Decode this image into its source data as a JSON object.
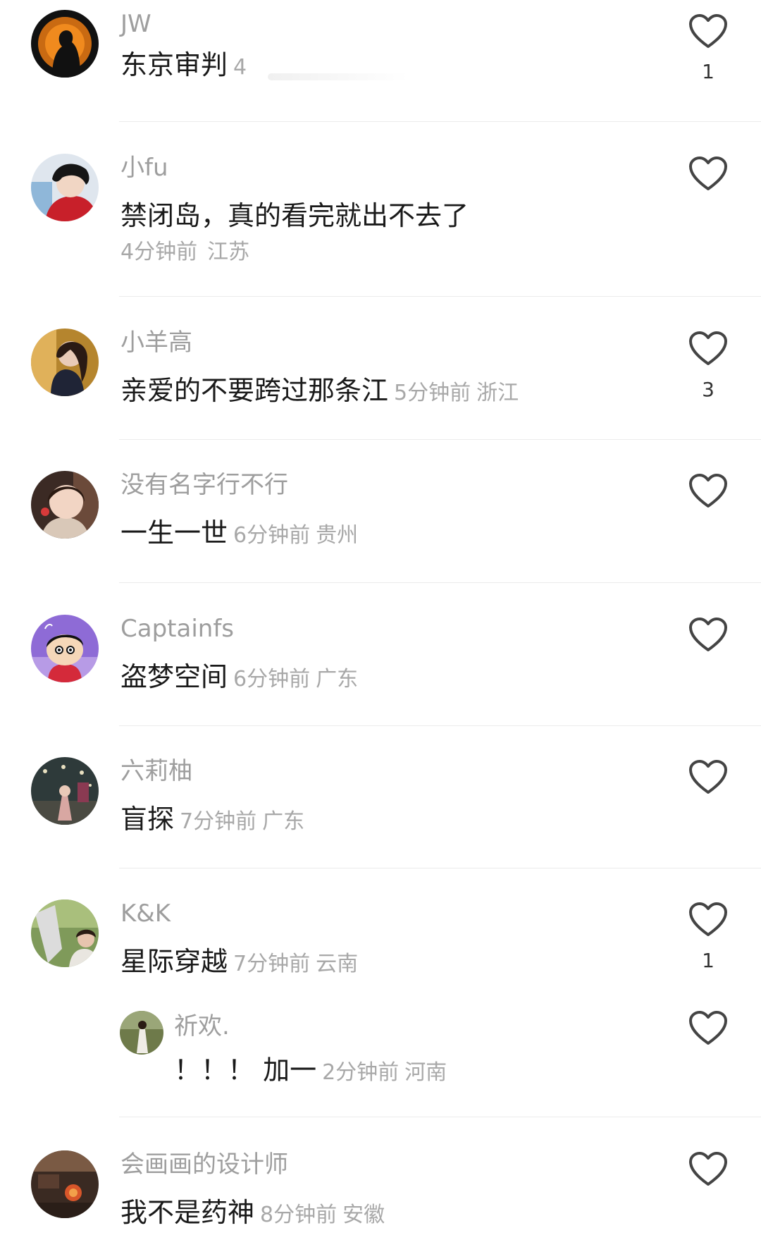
{
  "colors": {
    "username": "#9e9e9e",
    "text": "#1a1a1a",
    "meta": "#a8a8a8",
    "heart_stroke": "#444444",
    "divider": "#ebebeb"
  },
  "comments": [
    {
      "username": "JW",
      "text": "东京审判",
      "time": "4",
      "location": "",
      "likes": "1",
      "avatar_icon": "avatar-silhouette-icon"
    },
    {
      "username": "小fu",
      "text": "禁闭岛，真的看完就出不去了",
      "time": "4分钟前",
      "location": "江苏",
      "likes": "",
      "avatar_icon": "avatar-anime-icon"
    },
    {
      "username": "小羊高",
      "text": "亲爱的不要跨过那条江",
      "time": "5分钟前",
      "location": "浙江",
      "likes": "3",
      "avatar_icon": "avatar-photo-icon"
    },
    {
      "username": "没有名字行不行",
      "text": "一生一世",
      "time": "6分钟前",
      "location": "贵州",
      "likes": "",
      "avatar_icon": "avatar-child-icon"
    },
    {
      "username": "Captainfs",
      "text": "盗梦空间",
      "time": "6分钟前",
      "location": "广东",
      "likes": "",
      "avatar_icon": "avatar-cartoon-icon"
    },
    {
      "username": "六莉柚",
      "text": "盲探",
      "time": "7分钟前",
      "location": "广东",
      "likes": "",
      "avatar_icon": "avatar-stage-icon"
    },
    {
      "username": "K&K",
      "text": "星际穿越",
      "time": "7分钟前",
      "location": "云南",
      "likes": "1",
      "avatar_icon": "avatar-outdoor-icon"
    },
    {
      "username": "会画画的设计师",
      "text": "我不是药神",
      "time": "8分钟前",
      "location": "安徽",
      "likes": "",
      "avatar_icon": "avatar-room-icon"
    }
  ],
  "reply": {
    "username": "祈欢.",
    "text": "！！！ 加一",
    "time": "2分钟前",
    "location": "河南",
    "likes": "",
    "avatar_icon": "avatar-figure-icon"
  }
}
